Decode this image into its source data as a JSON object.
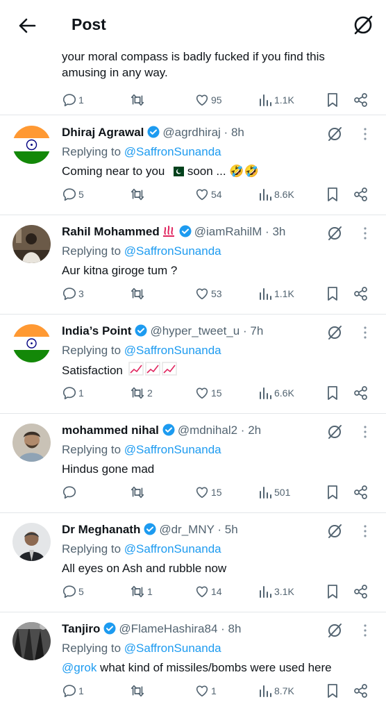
{
  "header": {
    "title": "Post"
  },
  "partial_post": {
    "text": "your moral compass is badly fucked if you find this amusing in any way.",
    "replies": "1",
    "reposts": "",
    "likes": "95",
    "views": "1.1K"
  },
  "replies": [
    {
      "name": "Dhiraj Agrawal",
      "handle": "@agrdhiraj",
      "dot": "·",
      "time": "8h",
      "replying_prefix": "Replying to",
      "replying_to": "@SaffronSunanda",
      "text_pre": "Coming near to you",
      "text_flag": "pakistan-flag-emoji",
      "text_post": " soon ... 🤣🤣",
      "replies": "5",
      "reposts": "",
      "likes": "54",
      "views": "8.6K"
    },
    {
      "name": "Rahil Mohammed",
      "name_emoji": "fire-emoji",
      "handle": "@iamRahilM",
      "dot": "·",
      "time": "3h",
      "replying_prefix": "Replying to",
      "replying_to": "@SaffronSunanda",
      "text": "Aur kitna giroge tum ?",
      "replies": "3",
      "reposts": "",
      "likes": "53",
      "views": "1.1K"
    },
    {
      "name": "India’s Point",
      "handle": "@hyper_tweet_u",
      "dot": "·",
      "time": "7h",
      "replying_prefix": "Replying to",
      "replying_to": "@SaffronSunanda",
      "text": "Satisfaction",
      "text_emoji": "chart-increasing-emoji x3",
      "replies": "1",
      "reposts": "2",
      "likes": "15",
      "views": "6.6K"
    },
    {
      "name": "mohammed nihal",
      "handle": "@mdnihal2",
      "dot": "·",
      "time": "2h",
      "replying_prefix": "Replying to",
      "replying_to": "@SaffronSunanda",
      "text": "Hindus gone mad",
      "replies": "",
      "reposts": "",
      "likes": "15",
      "views": "501"
    },
    {
      "name": "Dr Meghanath",
      "handle": "@dr_MNY",
      "dot": "·",
      "time": "5h",
      "replying_prefix": "Replying to",
      "replying_to": "@SaffronSunanda",
      "text": "All eyes on Ash and rubble now",
      "replies": "5",
      "reposts": "1",
      "likes": "14",
      "views": "3.1K"
    },
    {
      "name": "Tanjiro",
      "handle": "@FlameHashira84",
      "dot": "·",
      "time": "8h",
      "replying_prefix": "Replying to",
      "replying_to": "@SaffronSunanda",
      "text_mention": "@grok",
      "text": " what kind of missiles/bombs were used here",
      "replies": "1",
      "reposts": "",
      "likes": "1",
      "views": "8.7K"
    }
  ],
  "colors": {
    "accent": "#1d9bf0",
    "text": "#0f1419",
    "muted": "#536471",
    "divider": "#e3e6e9"
  }
}
